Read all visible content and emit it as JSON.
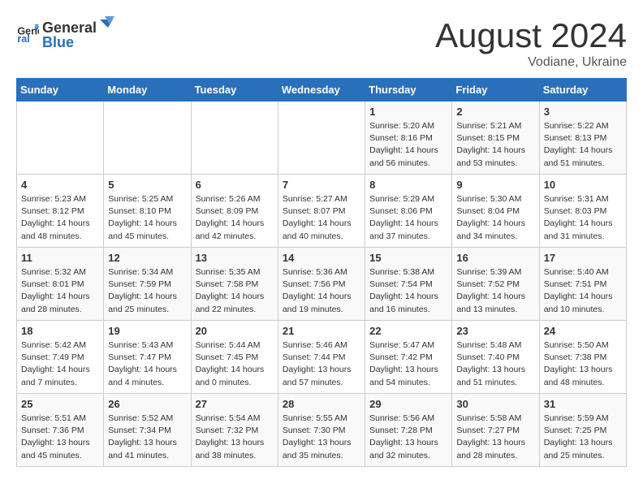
{
  "header": {
    "logo_general": "General",
    "logo_blue": "Blue",
    "month_title": "August 2024",
    "location": "Vodiane, Ukraine"
  },
  "days_of_week": [
    "Sunday",
    "Monday",
    "Tuesday",
    "Wednesday",
    "Thursday",
    "Friday",
    "Saturday"
  ],
  "weeks": [
    [
      {
        "day": "",
        "info": ""
      },
      {
        "day": "",
        "info": ""
      },
      {
        "day": "",
        "info": ""
      },
      {
        "day": "",
        "info": ""
      },
      {
        "day": "1",
        "info": "Sunrise: 5:20 AM\nSunset: 8:16 PM\nDaylight: 14 hours\nand 56 minutes."
      },
      {
        "day": "2",
        "info": "Sunrise: 5:21 AM\nSunset: 8:15 PM\nDaylight: 14 hours\nand 53 minutes."
      },
      {
        "day": "3",
        "info": "Sunrise: 5:22 AM\nSunset: 8:13 PM\nDaylight: 14 hours\nand 51 minutes."
      }
    ],
    [
      {
        "day": "4",
        "info": "Sunrise: 5:23 AM\nSunset: 8:12 PM\nDaylight: 14 hours\nand 48 minutes."
      },
      {
        "day": "5",
        "info": "Sunrise: 5:25 AM\nSunset: 8:10 PM\nDaylight: 14 hours\nand 45 minutes."
      },
      {
        "day": "6",
        "info": "Sunrise: 5:26 AM\nSunset: 8:09 PM\nDaylight: 14 hours\nand 42 minutes."
      },
      {
        "day": "7",
        "info": "Sunrise: 5:27 AM\nSunset: 8:07 PM\nDaylight: 14 hours\nand 40 minutes."
      },
      {
        "day": "8",
        "info": "Sunrise: 5:29 AM\nSunset: 8:06 PM\nDaylight: 14 hours\nand 37 minutes."
      },
      {
        "day": "9",
        "info": "Sunrise: 5:30 AM\nSunset: 8:04 PM\nDaylight: 14 hours\nand 34 minutes."
      },
      {
        "day": "10",
        "info": "Sunrise: 5:31 AM\nSunset: 8:03 PM\nDaylight: 14 hours\nand 31 minutes."
      }
    ],
    [
      {
        "day": "11",
        "info": "Sunrise: 5:32 AM\nSunset: 8:01 PM\nDaylight: 14 hours\nand 28 minutes."
      },
      {
        "day": "12",
        "info": "Sunrise: 5:34 AM\nSunset: 7:59 PM\nDaylight: 14 hours\nand 25 minutes."
      },
      {
        "day": "13",
        "info": "Sunrise: 5:35 AM\nSunset: 7:58 PM\nDaylight: 14 hours\nand 22 minutes."
      },
      {
        "day": "14",
        "info": "Sunrise: 5:36 AM\nSunset: 7:56 PM\nDaylight: 14 hours\nand 19 minutes."
      },
      {
        "day": "15",
        "info": "Sunrise: 5:38 AM\nSunset: 7:54 PM\nDaylight: 14 hours\nand 16 minutes."
      },
      {
        "day": "16",
        "info": "Sunrise: 5:39 AM\nSunset: 7:52 PM\nDaylight: 14 hours\nand 13 minutes."
      },
      {
        "day": "17",
        "info": "Sunrise: 5:40 AM\nSunset: 7:51 PM\nDaylight: 14 hours\nand 10 minutes."
      }
    ],
    [
      {
        "day": "18",
        "info": "Sunrise: 5:42 AM\nSunset: 7:49 PM\nDaylight: 14 hours\nand 7 minutes."
      },
      {
        "day": "19",
        "info": "Sunrise: 5:43 AM\nSunset: 7:47 PM\nDaylight: 14 hours\nand 4 minutes."
      },
      {
        "day": "20",
        "info": "Sunrise: 5:44 AM\nSunset: 7:45 PM\nDaylight: 14 hours\nand 0 minutes."
      },
      {
        "day": "21",
        "info": "Sunrise: 5:46 AM\nSunset: 7:44 PM\nDaylight: 13 hours\nand 57 minutes."
      },
      {
        "day": "22",
        "info": "Sunrise: 5:47 AM\nSunset: 7:42 PM\nDaylight: 13 hours\nand 54 minutes."
      },
      {
        "day": "23",
        "info": "Sunrise: 5:48 AM\nSunset: 7:40 PM\nDaylight: 13 hours\nand 51 minutes."
      },
      {
        "day": "24",
        "info": "Sunrise: 5:50 AM\nSunset: 7:38 PM\nDaylight: 13 hours\nand 48 minutes."
      }
    ],
    [
      {
        "day": "25",
        "info": "Sunrise: 5:51 AM\nSunset: 7:36 PM\nDaylight: 13 hours\nand 45 minutes."
      },
      {
        "day": "26",
        "info": "Sunrise: 5:52 AM\nSunset: 7:34 PM\nDaylight: 13 hours\nand 41 minutes."
      },
      {
        "day": "27",
        "info": "Sunrise: 5:54 AM\nSunset: 7:32 PM\nDaylight: 13 hours\nand 38 minutes."
      },
      {
        "day": "28",
        "info": "Sunrise: 5:55 AM\nSunset: 7:30 PM\nDaylight: 13 hours\nand 35 minutes."
      },
      {
        "day": "29",
        "info": "Sunrise: 5:56 AM\nSunset: 7:28 PM\nDaylight: 13 hours\nand 32 minutes."
      },
      {
        "day": "30",
        "info": "Sunrise: 5:58 AM\nSunset: 7:27 PM\nDaylight: 13 hours\nand 28 minutes."
      },
      {
        "day": "31",
        "info": "Sunrise: 5:59 AM\nSunset: 7:25 PM\nDaylight: 13 hours\nand 25 minutes."
      }
    ]
  ]
}
